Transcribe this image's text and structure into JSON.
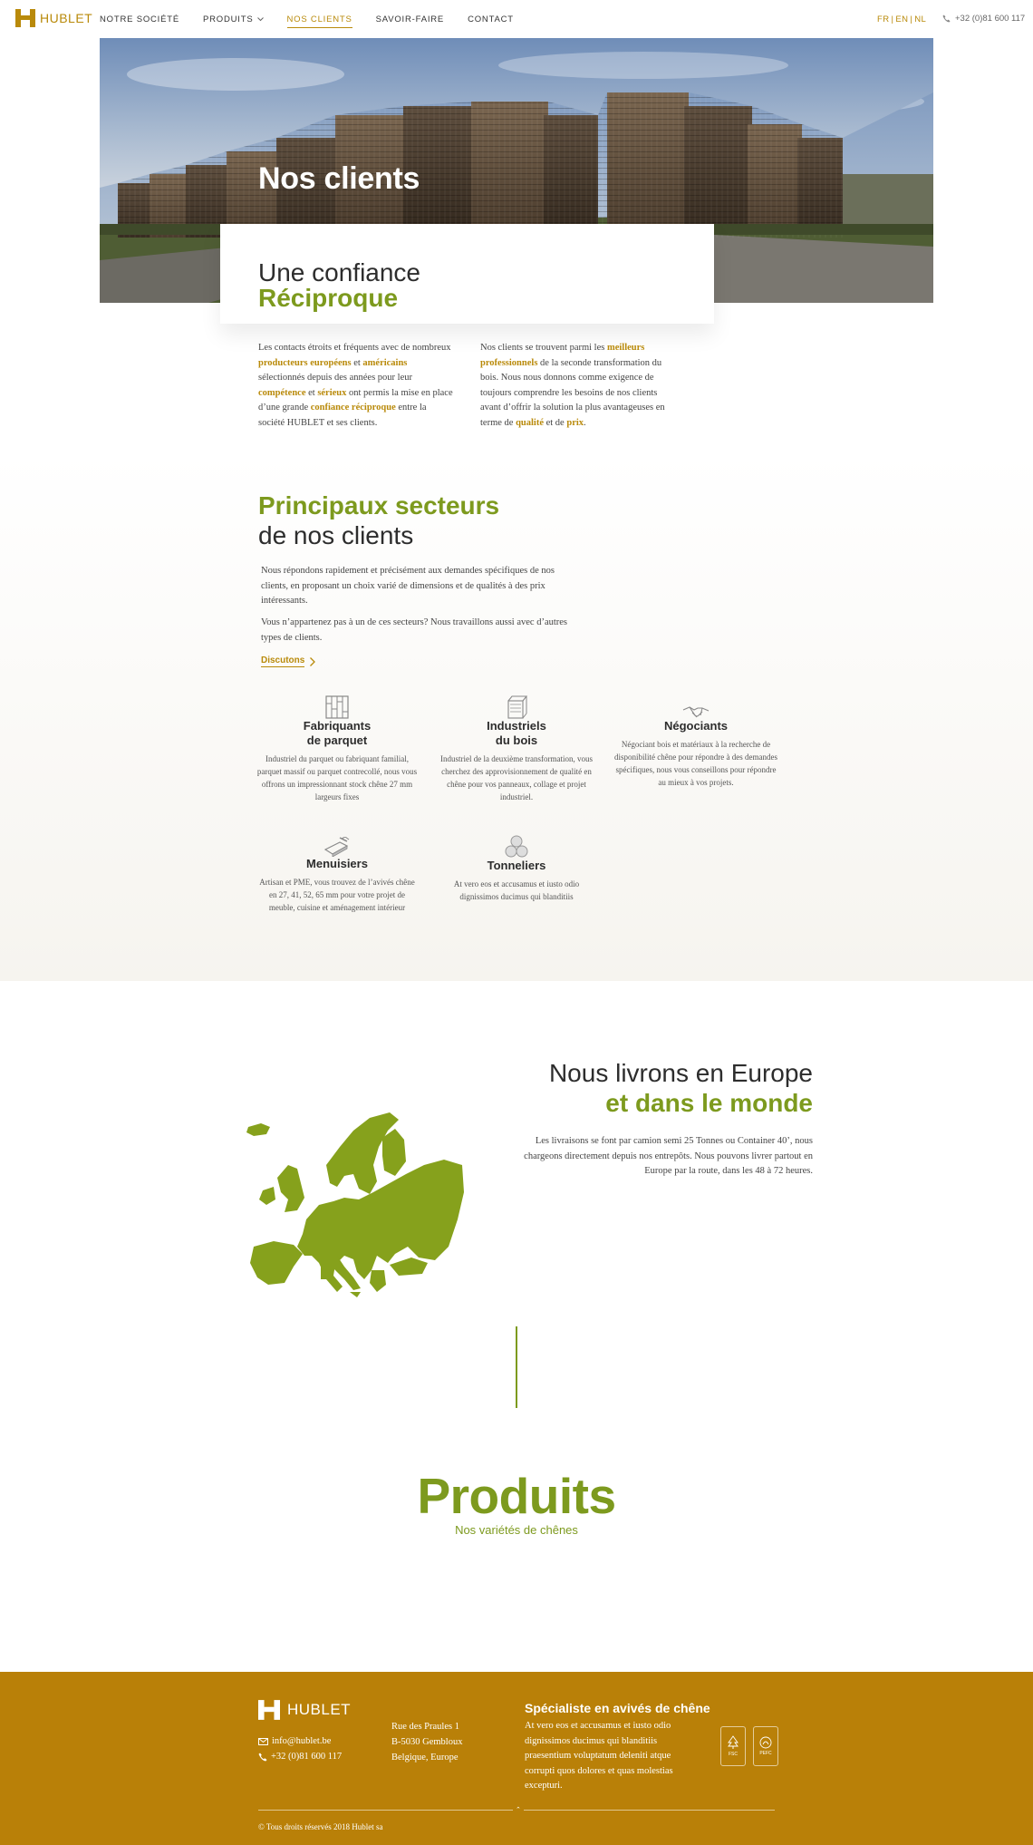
{
  "colors": {
    "accent_gold": "#b98a0a",
    "accent_green": "#7d9a1e",
    "footer_bg": "#b98008"
  },
  "header": {
    "brand": "HUBLET",
    "nav": [
      {
        "label": "NOTRE SOCIÉTÉ"
      },
      {
        "label": "PRODUITS"
      },
      {
        "label": "NOS CLIENTS"
      },
      {
        "label": "SAVOIR-FAIRE"
      },
      {
        "label": "CONTACT"
      }
    ],
    "langs": [
      "FR",
      "EN",
      "NL"
    ],
    "phone": "+32 (0)81 600 117"
  },
  "hero": {
    "title": "Nos clients",
    "card_line1": "Une confiance",
    "card_line2": "Réciproque"
  },
  "intro": {
    "left": [
      {
        "t": "Les contacts étroits et fréquents avec de nombreux "
      },
      {
        "t": "producteurs européens",
        "h": true
      },
      {
        "t": " et "
      },
      {
        "t": "américains",
        "h": true
      },
      {
        "t": " sélectionnés depuis des années pour leur "
      },
      {
        "t": "compétence",
        "h": true
      },
      {
        "t": " et "
      },
      {
        "t": "sérieux",
        "h": true
      },
      {
        "t": " ont permis la mise en place d’une grande "
      },
      {
        "t": "confiance réciproque",
        "h": true
      },
      {
        "t": " entre la société HUBLET et ses clients."
      }
    ],
    "right": [
      {
        "t": "Nos clients se trouvent parmi les "
      },
      {
        "t": "meilleurs professionnels",
        "h": true
      },
      {
        "t": " de la seconde transformation du bois. Nous nous donnons comme exigence de toujours comprendre les besoins de nos clients avant d’offrir la solution la plus avantageuses en terme de "
      },
      {
        "t": "qualité",
        "h": true
      },
      {
        "t": " et de "
      },
      {
        "t": "prix",
        "h": true
      },
      {
        "t": "."
      }
    ]
  },
  "sectors": {
    "title_line1": "Principaux secteurs",
    "title_line2": "de nos clients",
    "p1": "Nous répondons rapidement et précisément aux demandes spécifiques de nos clients, en proposant un choix varié de dimensions et de qualités à des prix intéressants.",
    "p2": "Vous n’appartenez pas à un de ces secteurs? Nous travaillons aussi avec d’autres types de clients.",
    "cta": "Discutons",
    "items": [
      {
        "icon": "parquet-icon",
        "title": "Fabriquants\nde parquet",
        "desc": "Industriel du parquet ou fabriquant familial, parquet massif ou parquet contrecollé, nous vous offrons un impressionnant stock chêne 27 mm largeurs fixes"
      },
      {
        "icon": "industrial-icon",
        "title": "Industriels\ndu bois",
        "desc": "Industriel de la deuxième transformation, vous cherchez des approvisionnement de qualité en chêne pour vos panneaux, collage et projet industriel."
      },
      {
        "icon": "handshake-icon",
        "title": "Négociants",
        "desc": "Négociant bois et matériaux à la recherche de disponibilité chêne pour répondre à des demandes spécifiques, nous vous conseillons pour répondre au mieux à vos projets."
      },
      {
        "icon": "saw-icon",
        "title": "Menuisiers",
        "desc": "Artisan et PME, vous trouvez de l’avivés chêne en 27, 41, 52, 65 mm pour votre projet de meuble, cuisine et aménagement intérieur"
      },
      {
        "icon": "barrels-icon",
        "title": "Tonneliers",
        "desc": "At vero eos et accusamus et iusto odio dignissimos ducimus qui blanditiis"
      }
    ]
  },
  "europe": {
    "title_line1": "Nous livrons en Europe",
    "title_line2": "et dans le monde",
    "text": "Les livraisons se font par camion semi 25 Tonnes ou Container 40’, nous chargeons directement depuis nos entrepôts. Nous pouvons livrer partout en Europe par la route, dans les 48 à 72 heures."
  },
  "products": {
    "title": "Produits",
    "subtitle": "Nos variétés de chênes"
  },
  "footer": {
    "brand": "HUBLET",
    "email": "info@hublet.be",
    "phone": "+32 (0)81 600 117",
    "address": [
      "Rue des Praules 1",
      "B-5030 Gembloux",
      "Belgique, Europe"
    ],
    "heading": "Spécialiste en avivés de chêne",
    "text": "At vero eos et accusamus et iusto odio dignissimos ducimus qui blanditiis praesentium voluptatum deleniti atque corrupti quos dolores et quas molestias excepturi.",
    "badges": [
      "FSC",
      "PEFC"
    ],
    "copyright": "© Tous droits réservés 2018 Hublet sa"
  }
}
